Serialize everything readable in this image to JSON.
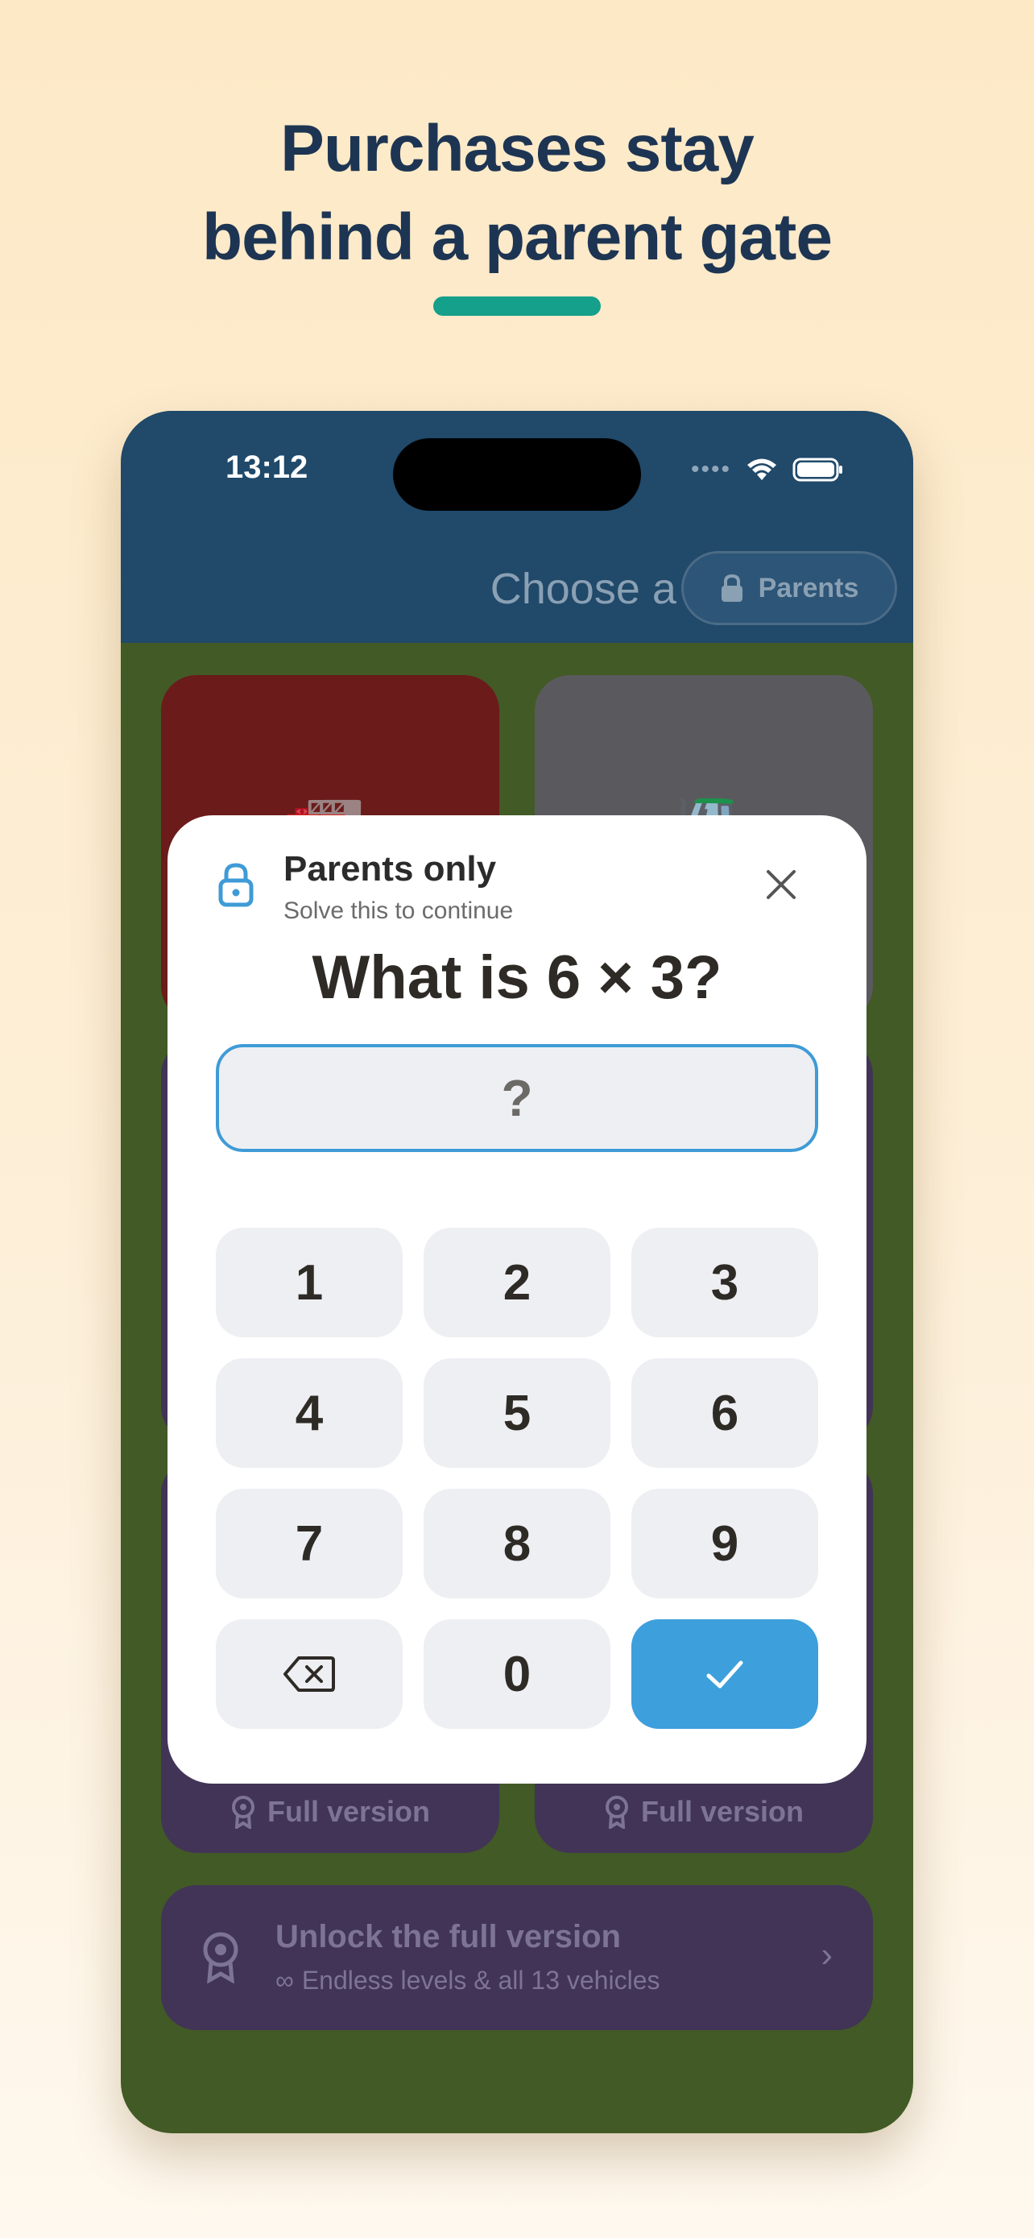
{
  "headline": {
    "line1": "Purchases stay",
    "line2": "behind a parent gate"
  },
  "status_bar": {
    "time": "13:12",
    "signal": "••••"
  },
  "header": {
    "title": "Choose a Road",
    "parents_button": "Parents"
  },
  "cards": {
    "full_version_label": "Full version"
  },
  "unlock_banner": {
    "title": "Unlock the full version",
    "subtitle": "Endless levels & all 13 vehicles"
  },
  "dialog": {
    "title": "Parents only",
    "subtitle": "Solve this to continue",
    "question": "What is 6 × 3?",
    "answer_placeholder": "?",
    "keys": [
      "1",
      "2",
      "3",
      "4",
      "5",
      "6",
      "7",
      "8",
      "9",
      "",
      "0",
      ""
    ]
  },
  "colors": {
    "accent_teal": "#14a08a",
    "header_blue": "#20496a",
    "confirm_blue": "#3d9fdc",
    "field_border": "#3f9bd6"
  }
}
